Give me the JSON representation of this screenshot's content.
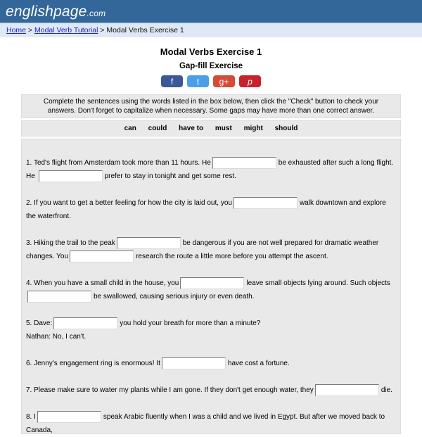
{
  "header": {
    "logo_main": "englishpage",
    "logo_tld": ".com",
    "brand_color": "#336699"
  },
  "breadcrumb": {
    "home": "Home",
    "sep1": " > ",
    "tutorial": "Modal Verb Tutorial",
    "sep2": " > ",
    "current": "Modal Verbs Exercise 1"
  },
  "page": {
    "title": "Modal Verbs Exercise 1",
    "subtitle": "Gap-fill Exercise"
  },
  "social": {
    "facebook": "f",
    "twitter": "t",
    "googleplus": "g+",
    "pinterest": "p"
  },
  "instructions": "Complete the sentences using the words listed in the box below, then click the \"Check\" button to check your answers. Don't forget to capitalize when necessary. Some gaps may have more than one correct answer.",
  "word_box": [
    "can",
    "could",
    "have to",
    "must",
    "might",
    "should"
  ],
  "questions": {
    "q1": {
      "a": "1. Ted's flight from Amsterdam took more than 11 hours. He",
      "b": "be exhausted after such a long flight. He",
      "c": "prefer to stay in tonight and get some rest."
    },
    "q2": {
      "a": "2. If you want to get a better feeling for how the city is laid out, you",
      "b": "walk downtown and explore the waterfront."
    },
    "q3": {
      "a": "3. Hiking the trail to the peak",
      "b": "be dangerous if you are not well prepared for dramatic weather changes. You",
      "c": "research the route a little more before you attempt the ascent."
    },
    "q4": {
      "a": "4. When you have a small child in the house, you",
      "b": "leave small objects lying around. Such objects",
      "c": "be swallowed, causing serious injury or even death."
    },
    "q5": {
      "a": "5. Dave:",
      "b": "you hold your breath for more than a minute?",
      "c": "Nathan: No, I can't."
    },
    "q6": {
      "a": "6. Jenny's engagement ring is enormous! It",
      "b": "have cost a fortune."
    },
    "q7": {
      "a": "7. Please make sure to water my plants while I am gone. If they don't get enough water, they",
      "b": "die."
    },
    "q8": {
      "a": "8. I",
      "b": "speak Arabic fluently when I was a child and we lived in Egypt. But after we moved back to Canada,"
    }
  },
  "gap_value": ""
}
